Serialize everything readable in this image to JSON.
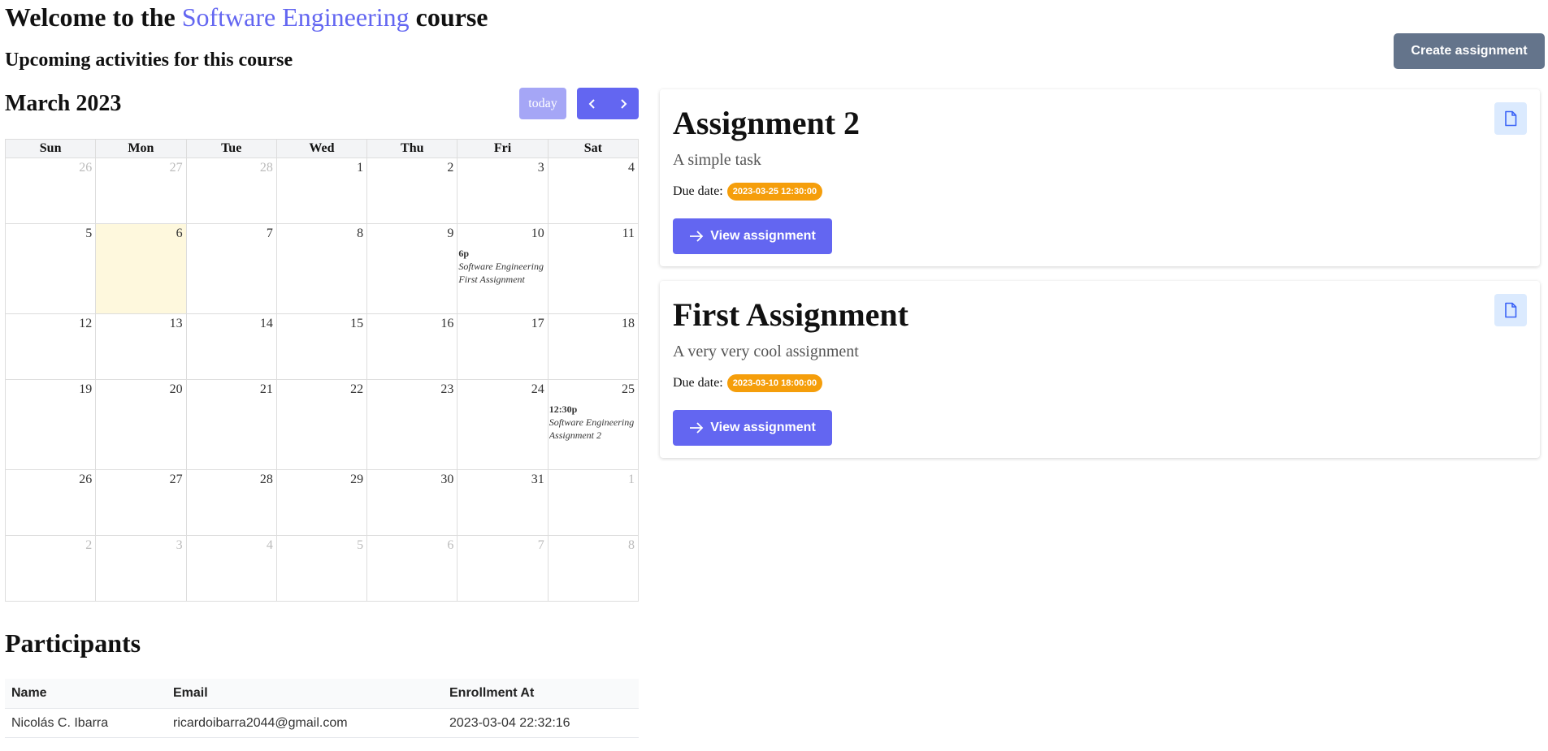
{
  "header": {
    "title_prefix": "Welcome to the",
    "course_name": "Software Engineering",
    "title_suffix": "course",
    "subtitle": "Upcoming activities for this course",
    "create_button": "Create assignment"
  },
  "calendar": {
    "title": "March 2023",
    "today_label": "today",
    "weekdays": [
      "Sun",
      "Mon",
      "Tue",
      "Wed",
      "Thu",
      "Fri",
      "Sat"
    ],
    "weeks": [
      [
        {
          "d": "26",
          "other": true
        },
        {
          "d": "27",
          "other": true
        },
        {
          "d": "28",
          "other": true
        },
        {
          "d": "1"
        },
        {
          "d": "2"
        },
        {
          "d": "3"
        },
        {
          "d": "4"
        }
      ],
      [
        {
          "d": "5"
        },
        {
          "d": "6",
          "today": true
        },
        {
          "d": "7"
        },
        {
          "d": "8"
        },
        {
          "d": "9"
        },
        {
          "d": "10",
          "event": {
            "time": "6p",
            "course": "Software Engineering",
            "name": "First Assignment"
          }
        },
        {
          "d": "11"
        }
      ],
      [
        {
          "d": "12"
        },
        {
          "d": "13"
        },
        {
          "d": "14"
        },
        {
          "d": "15"
        },
        {
          "d": "16"
        },
        {
          "d": "17"
        },
        {
          "d": "18"
        }
      ],
      [
        {
          "d": "19"
        },
        {
          "d": "20"
        },
        {
          "d": "21"
        },
        {
          "d": "22"
        },
        {
          "d": "23"
        },
        {
          "d": "24"
        },
        {
          "d": "25",
          "event": {
            "time": "12:30p",
            "course": "Software Engineering",
            "name": "Assignment 2"
          }
        }
      ],
      [
        {
          "d": "26"
        },
        {
          "d": "27"
        },
        {
          "d": "28"
        },
        {
          "d": "29"
        },
        {
          "d": "30"
        },
        {
          "d": "31"
        },
        {
          "d": "1",
          "other": true
        }
      ],
      [
        {
          "d": "2",
          "other": true
        },
        {
          "d": "3",
          "other": true
        },
        {
          "d": "4",
          "other": true
        },
        {
          "d": "5",
          "other": true
        },
        {
          "d": "6",
          "other": true
        },
        {
          "d": "7",
          "other": true
        },
        {
          "d": "8",
          "other": true
        }
      ]
    ]
  },
  "participants": {
    "title": "Participants",
    "columns": [
      "Name",
      "Email",
      "Enrollment At"
    ],
    "rows": [
      [
        "Nicolás C. Ibarra",
        "ricardoibarra2044@gmail.com",
        "2023-03-04 22:32:16"
      ]
    ]
  },
  "assignments": [
    {
      "title": "Assignment 2",
      "description": "A simple task",
      "due_label": "Due date:",
      "due_date": "2023-03-25 12:30:00",
      "button": "View assignment",
      "icon": "document-icon"
    },
    {
      "title": "First Assignment",
      "description": "A very very cool assignment",
      "due_label": "Due date:",
      "due_date": "2023-03-10 18:00:00",
      "button": "View assignment",
      "icon": "document-icon"
    }
  ],
  "colors": {
    "accent": "#6366f1",
    "badge": "#f59e0b",
    "create_button": "#64748b",
    "today_cell": "#fef8dd"
  }
}
